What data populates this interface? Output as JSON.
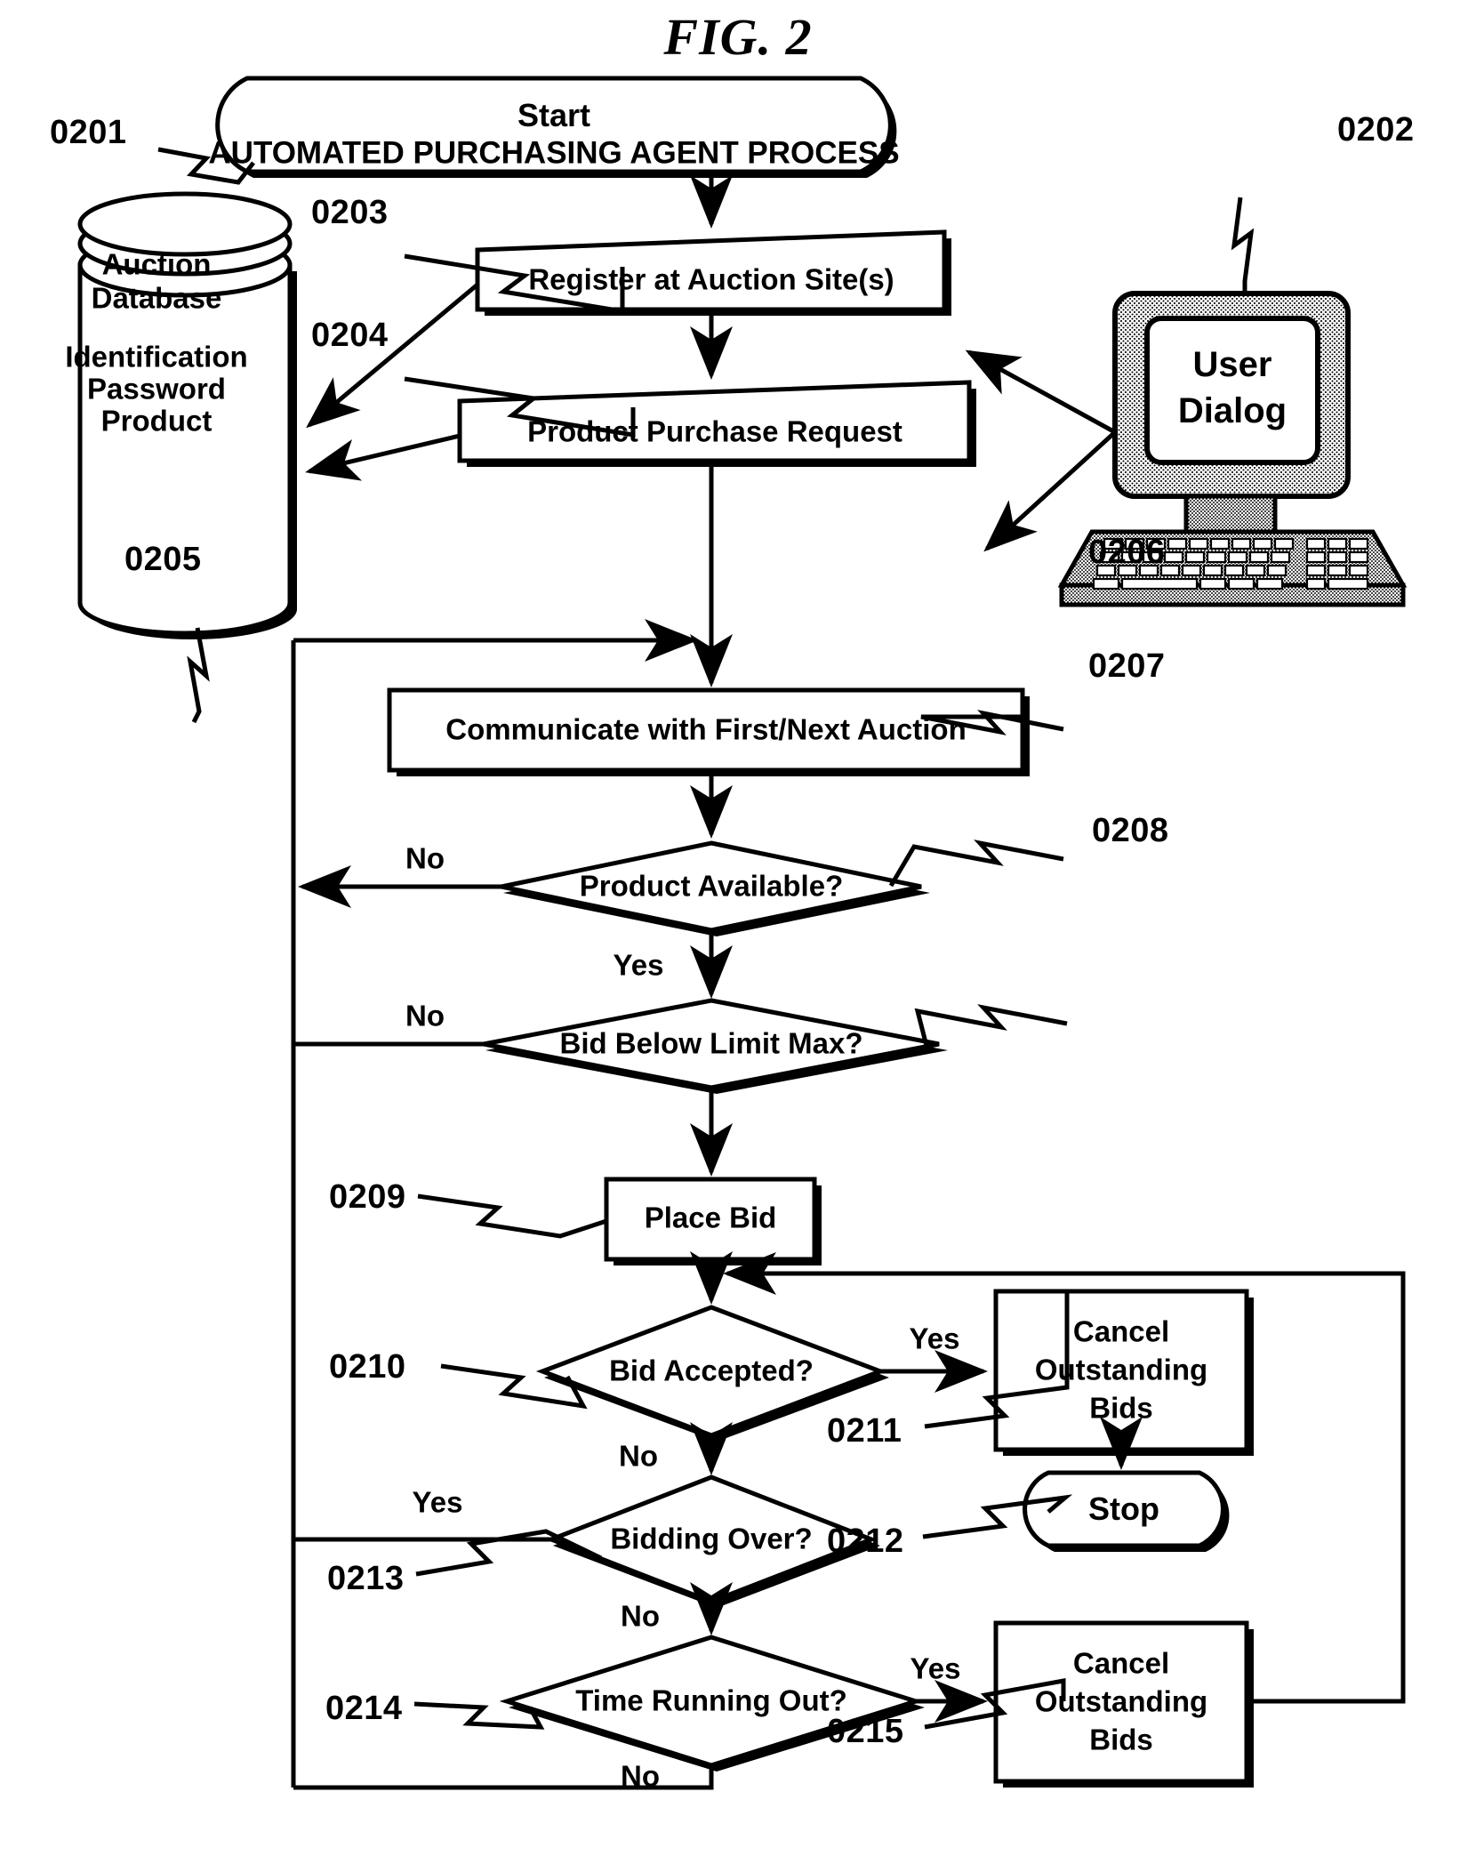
{
  "figure": {
    "title": "FIG. 2"
  },
  "nodes": {
    "start": {
      "ref": "0201",
      "line1": "Start",
      "line2": "AUTOMATED PURCHASING AGENT PROCESS"
    },
    "user_dialog": {
      "ref": "0202",
      "line1": "User",
      "line2": "Dialog"
    },
    "register": {
      "ref": "0203",
      "label": "Register at Auction Site(s)"
    },
    "purchase_request": {
      "ref": "0204",
      "label": "Product Purchase Request"
    },
    "database": {
      "ref": "0205",
      "line1": "Auction",
      "line2": "Database",
      "line3": "Identification",
      "line4": "Password",
      "line5": "Product"
    },
    "communicate": {
      "ref": "0206",
      "label": "Communicate with First/Next Auction"
    },
    "product_available": {
      "ref": "0207",
      "label": "Product Available?",
      "branch_no": "No",
      "branch_yes": "Yes"
    },
    "bid_below_limit": {
      "ref": "0208",
      "label": "Bid Below Limit Max?",
      "branch_no": "No"
    },
    "place_bid": {
      "ref": "0209",
      "label": "Place Bid"
    },
    "bid_accepted": {
      "ref": "0210",
      "label": "Bid Accepted?",
      "branch_yes": "Yes",
      "branch_no": "No"
    },
    "cancel_bids_top": {
      "ref": "0211",
      "line1": "Cancel",
      "line2": "Outstanding",
      "line3": "Bids"
    },
    "stop": {
      "ref": "0212",
      "label": "Stop"
    },
    "bidding_over": {
      "ref": "0213",
      "label": "Bidding Over?",
      "branch_yes": "Yes",
      "branch_no": "No"
    },
    "time_running_out": {
      "ref": "0214",
      "label": "Time Running Out?",
      "branch_yes": "Yes",
      "branch_no": "No"
    },
    "cancel_bids_bottom": {
      "ref": "0215",
      "line1": "Cancel",
      "line2": "Outstanding",
      "line3": "Bids"
    }
  },
  "colors": {
    "stroke": "#000000",
    "fill": "#ffffff",
    "shadow": "#000000",
    "stipple": "#000000"
  }
}
